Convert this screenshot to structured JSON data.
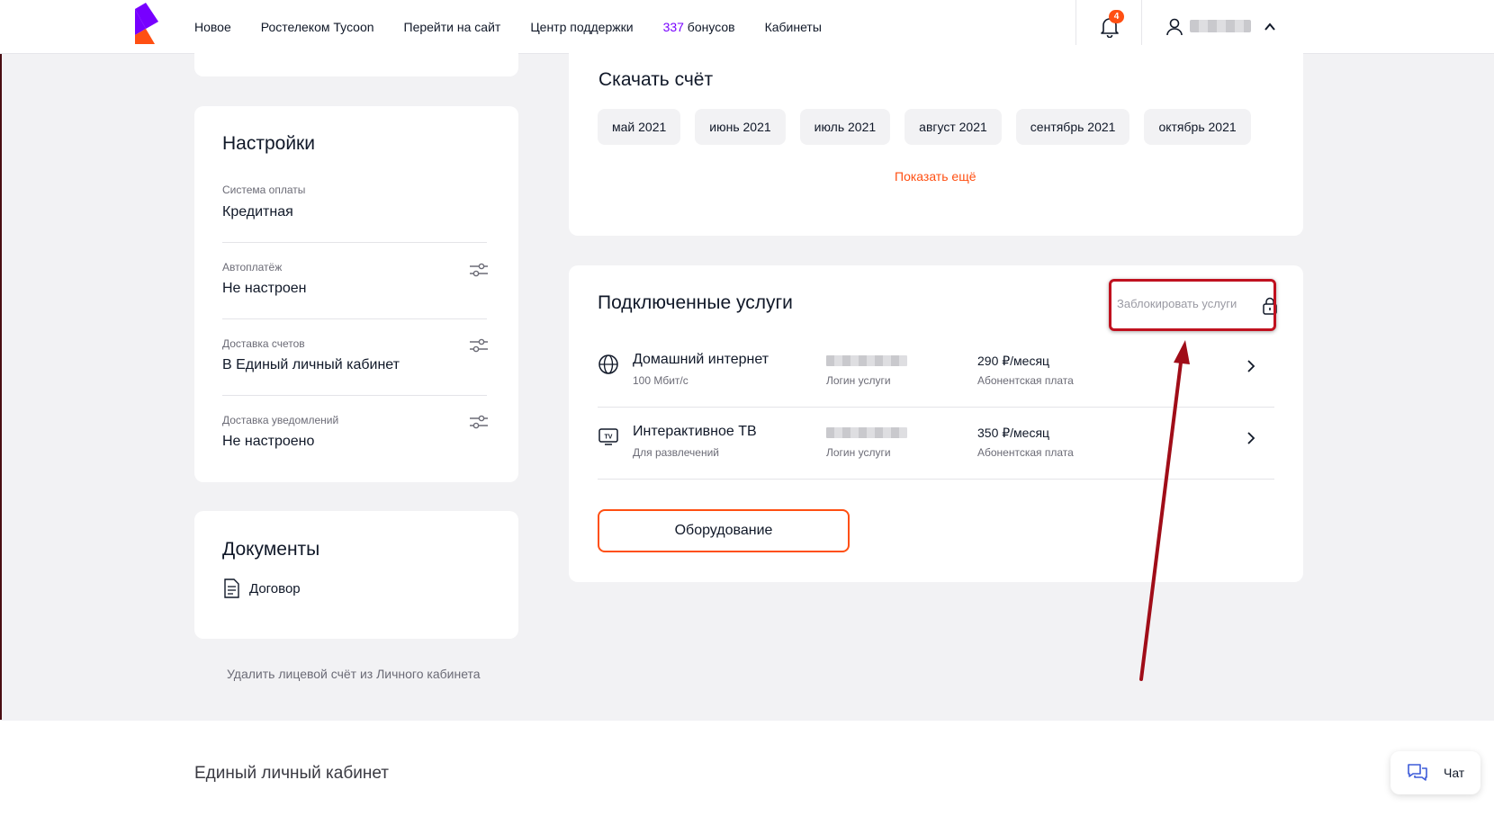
{
  "header": {
    "nav": [
      "Новое",
      "Ростелеком Tycoon",
      "Перейти на сайт",
      "Центр поддержки"
    ],
    "bonus_count": "337",
    "bonus_label": " бонусов",
    "cabinets": "Кабинеты",
    "notifications_count": "4"
  },
  "settings": {
    "title": "Настройки",
    "items": [
      {
        "label": "Система оплаты",
        "value": "Кредитная"
      },
      {
        "label": "Автоплатёж",
        "value": "Не настроен"
      },
      {
        "label": "Доставка счетов",
        "value": "В Единый личный кабинет"
      },
      {
        "label": "Доставка уведомлений",
        "value": "Не настроено"
      }
    ]
  },
  "documents": {
    "title": "Документы",
    "contract": "Договор"
  },
  "delete_account": "Удалить лицевой счёт из Личного кабинета",
  "invoice": {
    "title": "Скачать счёт",
    "months": [
      "май 2021",
      "июнь 2021",
      "июль 2021",
      "август 2021",
      "сентябрь 2021",
      "октябрь 2021"
    ],
    "show_more": "Показать ещё"
  },
  "services": {
    "title": "Подключенные услуги",
    "block_label": "Заблокировать услуги",
    "items": [
      {
        "name": "Домашний интернет",
        "sub": "100 Мбит/с",
        "login_label": "Логин услуги",
        "price": "290 ₽/месяц",
        "price_label": "Абонентская плата"
      },
      {
        "name": "Интерактивное ТВ",
        "sub": "Для развлечений",
        "login_label": "Логин услуги",
        "price": "350 ₽/месяц",
        "price_label": "Абонентская плата"
      }
    ],
    "equipment_button": "Оборудование"
  },
  "footer": {
    "title": "Единый личный кабинет"
  },
  "chat": "Чат",
  "colors": {
    "accent": "#ff4f12",
    "brand_purple": "#7700ff",
    "annotation_red": "#c0111f"
  }
}
